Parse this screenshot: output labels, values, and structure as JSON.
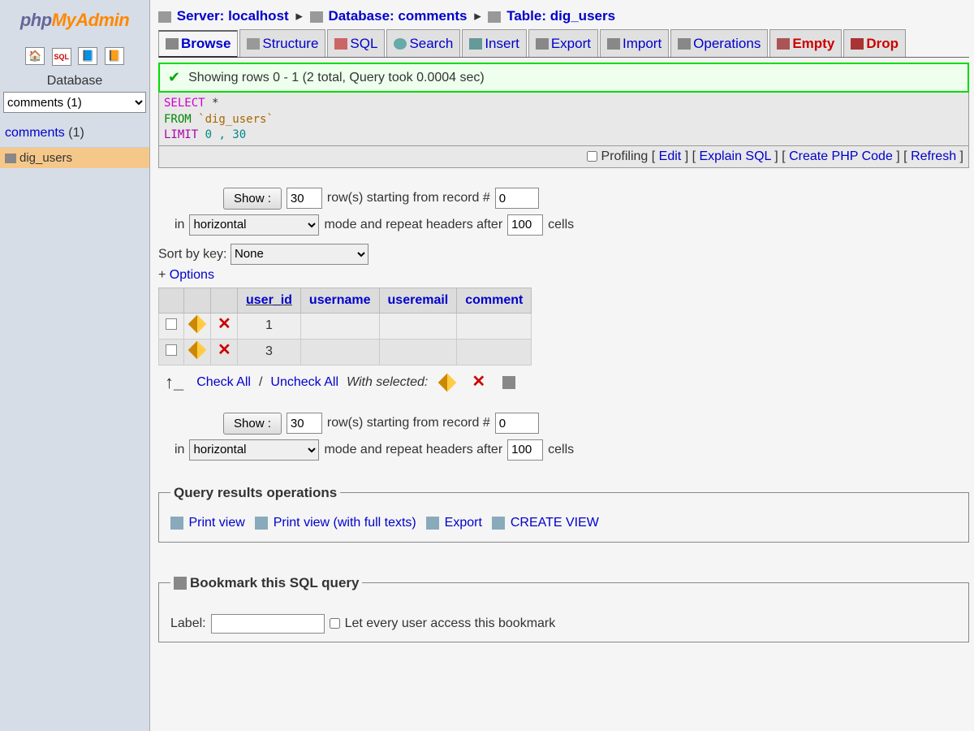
{
  "sidebar": {
    "logo1": "php",
    "logo2": "MyAdmin",
    "db_label": "Database",
    "db_select": "comments (1)",
    "db_link": "comments",
    "db_count": " (1)",
    "table": "dig_users"
  },
  "breadcrumb": {
    "server_label": "Server: ",
    "server": "localhost",
    "db_label": "Database: ",
    "db": "comments",
    "tbl_label": "Table: ",
    "tbl": "dig_users"
  },
  "tabs": {
    "browse": "Browse",
    "structure": "Structure",
    "sql": "SQL",
    "search": "Search",
    "insert": "Insert",
    "export": "Export",
    "import": "Import",
    "operations": "Operations",
    "empty": "Empty",
    "drop": "Drop"
  },
  "success": "Showing rows 0 - 1 (2 total, Query took 0.0004 sec)",
  "sql": {
    "select": "SELECT",
    "star": " *",
    "from": "FROM",
    "table": " `dig_users`",
    "limit": "LIMIT",
    "nums": " 0 , 30"
  },
  "sql_actions": {
    "profiling": "Profiling",
    "edit": "Edit",
    "explain": "Explain SQL",
    "php": "Create PHP Code",
    "refresh": "Refresh"
  },
  "ctrl": {
    "show": "Show :",
    "rows": "30",
    "rows_label": "row(s) starting from record #",
    "start": "0",
    "in": "in",
    "mode": "horizontal",
    "mode_label": "mode and repeat headers after",
    "repeat": "100",
    "cells": "cells",
    "sortkey": "Sort by key:",
    "sortkey_val": "None",
    "options": "Options"
  },
  "table": {
    "headers": [
      "user_id",
      "username",
      "useremail",
      "comment"
    ],
    "rows": [
      {
        "id": "1"
      },
      {
        "id": "3"
      }
    ]
  },
  "bulk": {
    "check_all": "Check All",
    "uncheck_all": "Uncheck All",
    "with_selected": "With selected:"
  },
  "ops": {
    "legend": "Query results operations",
    "print": "Print view",
    "print_full": "Print view (with full texts)",
    "export": "Export",
    "create_view": "CREATE VIEW"
  },
  "bookmark": {
    "legend": "Bookmark this SQL query",
    "label": "Label:",
    "public": "Let every user access this bookmark"
  }
}
